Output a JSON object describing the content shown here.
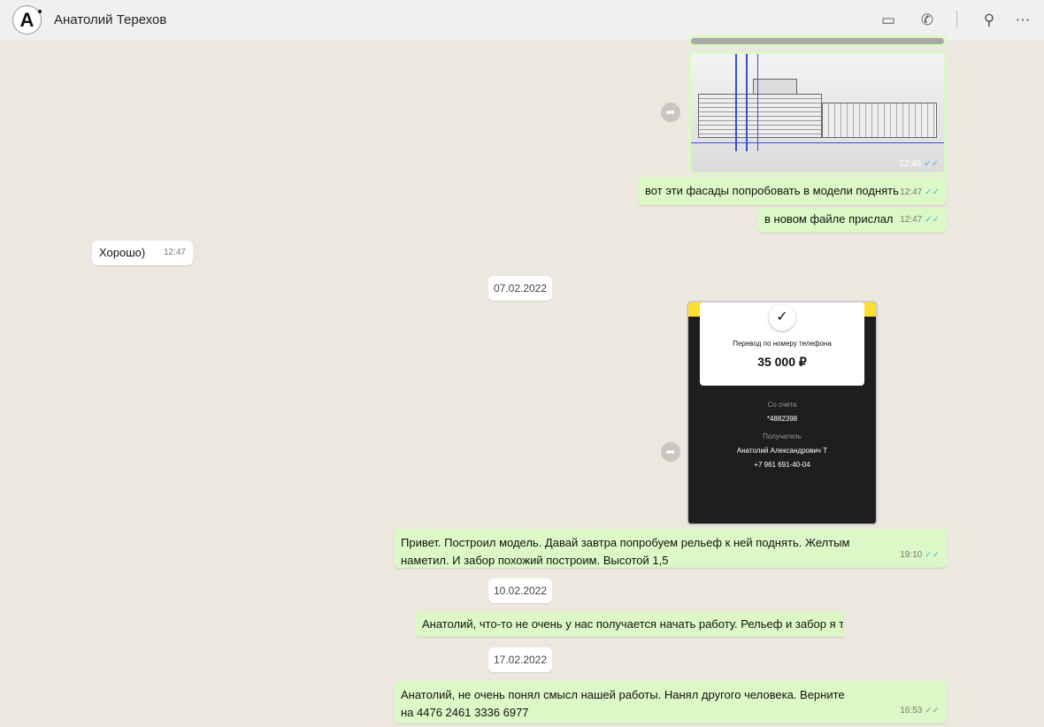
{
  "header": {
    "contact_name": "Анатолий Терехов",
    "avatar_letter": "A"
  },
  "messages": [
    {
      "type": "image",
      "time": "12:46"
    },
    {
      "text": "вот эти фасады попробовать в модели поднять",
      "time": "12:47"
    },
    {
      "text": "в новом файле прислал",
      "time": "12:47"
    },
    {
      "text": "Хорошо)",
      "time": "12:47"
    },
    {
      "text": "Привет. Построил модель. Давай завтра попробуем рельеф к ней поднять. Желтым наметил. И забор похожий построим. Высотой 1,5",
      "time": "19:10"
    },
    {
      "text": "Анатолий, что-то не очень у нас получается начать работу. Рельеф и забор я тоже"
    },
    {
      "text": "Анатолий, не очень понял смысл нашей работы.  Нанял другого человека. Верните ава",
      "text2": "на 4476 2461 3336 6977",
      "time": "16:53"
    }
  ],
  "dates": [
    "07.02.2022",
    "10.02.2022",
    "17.02.2022"
  ],
  "receipt": {
    "title": "Перевод по номеру телефона",
    "amount": "35 000 ₽",
    "from_label": "Со счета",
    "from": "*4882398",
    "to_label": "Получатель",
    "to_name": "Анатолий Александрович Т",
    "to_phone": "+7 961 691-40-04"
  },
  "ticks": "✓✓"
}
